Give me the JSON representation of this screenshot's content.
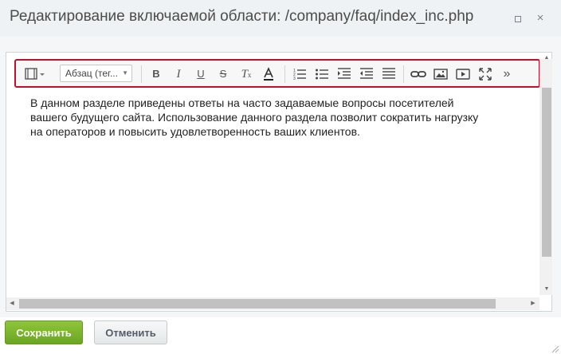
{
  "dialog": {
    "title": "Редактирование включаемой области: /company/faq/index_inc.php",
    "maximize_icon": "maximize-icon",
    "close_glyph": "×"
  },
  "toolbar": {
    "style_select_value": "Абзац (тег...",
    "bold_label": "B",
    "italic_label": "I",
    "underline_label": "U",
    "strike_label": "S",
    "remove_format_label": "T",
    "more_label": "»",
    "icons": [
      "template-icon",
      "bold-icon",
      "italic-icon",
      "underline-icon",
      "strikethrough-icon",
      "remove-format-icon",
      "text-color-icon",
      "ordered-list-icon",
      "unordered-list-icon",
      "indent-icon",
      "outdent-icon",
      "align-icon",
      "link-icon",
      "image-icon",
      "video-icon",
      "fullscreen-icon",
      "more-icon"
    ]
  },
  "content": {
    "lines": [
      "В данном разделе приведены ответы на часто задаваемые вопросы посетителей",
      "вашего будущего сайта. Использование данного раздела позволит сократить нагрузку",
      "на операторов и повысить удовлетворенность ваших клиентов."
    ]
  },
  "buttons": {
    "save_label": "Сохранить",
    "cancel_label": "Отменить"
  },
  "colors": {
    "highlight": "#c0102c",
    "save_green": "#7ab32f"
  }
}
